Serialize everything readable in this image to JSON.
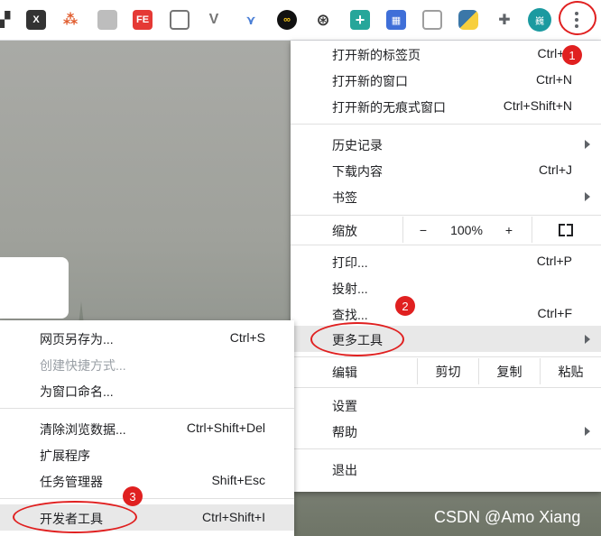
{
  "toolbar": {
    "extensions": [
      {
        "icon": "puzzle-fragment-icon",
        "text": "",
        "color": "#333333"
      },
      {
        "icon": "x-app-icon",
        "text": "X",
        "color": "#333333"
      },
      {
        "icon": "network-tree-icon",
        "text": "",
        "color": "#e05a2b"
      },
      {
        "icon": "grayscale-icon",
        "text": "",
        "color": "#9e9e9e"
      },
      {
        "icon": "fe-helper-icon",
        "text": "FE",
        "color": "#e53935"
      },
      {
        "icon": "window-icon",
        "text": "",
        "color": "#757575"
      },
      {
        "icon": "vue-devtools-icon",
        "text": "V",
        "color": "#757575"
      },
      {
        "icon": "chevrons-down-icon",
        "text": "",
        "color": "#4a7fd6"
      },
      {
        "icon": "infinity-icon",
        "text": "∞",
        "color": "#111111"
      },
      {
        "icon": "film-reel-icon",
        "text": "",
        "color": "#333333"
      },
      {
        "icon": "plus-square-icon",
        "text": "+",
        "color": "#26a69a"
      },
      {
        "icon": "qr-code-icon",
        "text": "",
        "color": "#3f6fd8"
      },
      {
        "icon": "bookmark-tag-icon",
        "text": "",
        "color": "#9e9e9e"
      },
      {
        "icon": "python-icon",
        "text": "",
        "color": "#3b77a8"
      },
      {
        "icon": "extensions-puzzle-icon",
        "text": "",
        "color": "#5f6368"
      }
    ],
    "avatar_text": "巍"
  },
  "main_menu": {
    "new_tab": {
      "label": "打开新的标签页",
      "shortcut": "Ctrl+T"
    },
    "new_window": {
      "label": "打开新的窗口",
      "shortcut": "Ctrl+N"
    },
    "new_incognito": {
      "label": "打开新的无痕式窗口",
      "shortcut": "Ctrl+Shift+N"
    },
    "history": {
      "label": "历史记录"
    },
    "downloads": {
      "label": "下载内容",
      "shortcut": "Ctrl+J"
    },
    "bookmarks": {
      "label": "书签"
    },
    "zoom": {
      "label": "缩放",
      "minus": "−",
      "value": "100%",
      "plus": "+"
    },
    "print": {
      "label": "打印...",
      "shortcut": "Ctrl+P"
    },
    "cast": {
      "label": "投射..."
    },
    "find": {
      "label": "查找...",
      "shortcut": "Ctrl+F"
    },
    "more_tools": {
      "label": "更多工具"
    },
    "edit": {
      "label": "编辑",
      "cut": "剪切",
      "copy": "复制",
      "paste": "粘贴"
    },
    "settings": {
      "label": "设置"
    },
    "help": {
      "label": "帮助"
    },
    "exit": {
      "label": "退出"
    }
  },
  "sub_menu": {
    "save_page": {
      "label": "网页另存为...",
      "shortcut": "Ctrl+S"
    },
    "create_shortcut": {
      "label": "创建快捷方式..."
    },
    "name_window": {
      "label": "为窗口命名..."
    },
    "clear_data": {
      "label": "清除浏览数据...",
      "shortcut": "Ctrl+Shift+Del"
    },
    "extensions": {
      "label": "扩展程序"
    },
    "task_manager": {
      "label": "任务管理器",
      "shortcut": "Shift+Esc"
    },
    "dev_tools": {
      "label": "开发者工具",
      "shortcut": "Ctrl+Shift+I"
    }
  },
  "annotations": {
    "step1": "1",
    "step2": "2",
    "step3": "3",
    "accent": "#e02020"
  },
  "watermark": "CSDN @Amo Xiang"
}
